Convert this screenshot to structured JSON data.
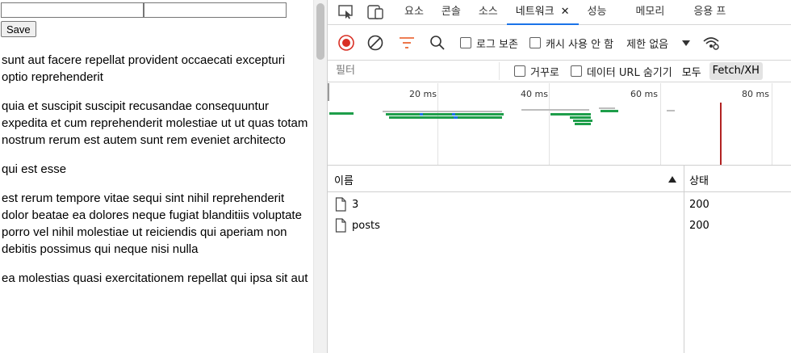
{
  "page": {
    "input1_value": "",
    "input2_value": "",
    "save_label": "Save",
    "posts": [
      "sunt aut facere repellat provident occaecati excepturi optio reprehenderit",
      "quia et suscipit suscipit recusandae consequuntur expedita et cum reprehenderit molestiae ut ut quas totam nostrum rerum est autem sunt rem eveniet architecto",
      "qui est esse",
      "est rerum tempore vitae sequi sint nihil reprehenderit dolor beatae ea dolores neque fugiat blanditiis voluptate porro vel nihil molestiae ut reiciendis qui aperiam non debitis possimus qui neque nisi nulla",
      "ea molestias quasi exercitationem repellat qui ipsa sit aut"
    ]
  },
  "devtools": {
    "icons": [
      "inspect-icon",
      "device-toggle-icon"
    ],
    "tabs": [
      {
        "label": "요소",
        "active": false
      },
      {
        "label": "콘솔",
        "active": false
      },
      {
        "label": "소스",
        "active": false
      },
      {
        "label": "네트워크",
        "active": true,
        "close": "✕"
      },
      {
        "label": "성능",
        "active": false
      },
      {
        "label": "메모리",
        "active": false
      },
      {
        "label": "응용 프",
        "active": false
      }
    ],
    "toolbar": {
      "preserve_log": "로그 보존",
      "disable_cache": "캐시 사용 안 함",
      "throttling": "제한 없음",
      "accent_red": "#d93025",
      "filter_accent": "#e8541c"
    },
    "filterbar": {
      "placeholder": "필터",
      "invert": "거꾸로",
      "hide_data_urls": "데이터 URL 숨기기",
      "all": "모두",
      "fetch_xhr": "Fetch/XH"
    },
    "timeline": {
      "ticks": [
        "20 ms",
        "40 ms",
        "60 ms",
        "80 ms"
      ],
      "bar_color": "#1e9e4a",
      "wait_color": "#1a73e8",
      "marker_color": "#b22222"
    },
    "table": {
      "col_name": "이름",
      "col_status": "상태",
      "rows": [
        {
          "name": "3",
          "status": "200"
        },
        {
          "name": "posts",
          "status": "200"
        }
      ]
    }
  }
}
